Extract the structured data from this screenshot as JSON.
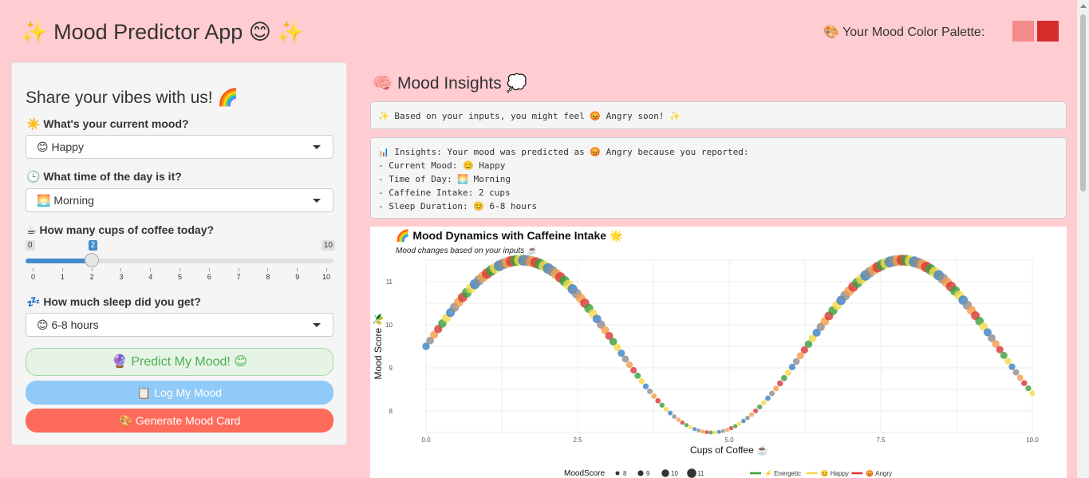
{
  "app": {
    "title": "✨ Mood Predictor App 😊 ✨",
    "palette_label": "🎨 Your Mood Color Palette:",
    "palette_colors": [
      "#f28b8b",
      "#d62c2c"
    ]
  },
  "sidebar": {
    "heading": "Share your vibes with us! 🌈",
    "mood_label": "☀️ What's your current mood?",
    "mood_value": "😊 Happy",
    "time_label": "🕒 What time of the day is it?",
    "time_value": "🌅 Morning",
    "coffee_label": "☕ How many cups of coffee today?",
    "coffee": {
      "min": "0",
      "max": "10",
      "value": "2",
      "value_num": 2,
      "ticks": [
        "0",
        "1",
        "2",
        "3",
        "4",
        "5",
        "6",
        "7",
        "8",
        "9",
        "10"
      ]
    },
    "sleep_label": "💤 How much sleep did you get?",
    "sleep_value": "😊 6-8 hours",
    "predict_button": "🔮 Predict My Mood! 😊",
    "log_button": "📋 Log My Mood",
    "card_button": "🎨 Generate Mood Card"
  },
  "main": {
    "title": "🧠 Mood Insights 💭",
    "prediction_text": "✨ Based on your inputs, you might feel 😡 Angry soon! ✨",
    "insights_text": "📊 Insights: Your mood was predicted as 😡 Angry because you reported:\n- Current Mood: 😊 Happy\n- Time of Day: 🌅 Morning\n- Caffeine Intake: 2 cups\n- Sleep Duration: 😊 6-8 hours"
  },
  "chart_data": {
    "type": "scatter",
    "title": "🌈 Mood Dynamics with Caffeine Intake 🌟",
    "subtitle": "Mood changes based on your inputs ☕",
    "xlabel": "Cups of Coffee ☕",
    "ylabel": "Mood Score 🫒",
    "xlim": [
      0,
      10
    ],
    "ylim": [
      7.5,
      11.5
    ],
    "x_ticks": [
      "0.0",
      "2.5",
      "5.0",
      "7.5",
      "10.0"
    ],
    "y_ticks": [
      "8",
      "9",
      "10",
      "11"
    ],
    "grid": true,
    "curve": "y = 9.5 + 2*sin(x)",
    "n_points": 150,
    "legend": {
      "size_title": "MoodScore",
      "size_values": [
        "8",
        "9",
        "10",
        "11"
      ],
      "color_entries": [
        {
          "label": "⚡ Energetic",
          "color": "#3a9e3a"
        },
        {
          "label": "😊 Happy",
          "color": "#f5d94a"
        },
        {
          "label": "😡 Angry",
          "color": "#d93636"
        }
      ]
    },
    "point_colors": [
      "#d93636",
      "#3a9e3a",
      "#f5d94a",
      "#3b7fc4",
      "#8c8c8c",
      "#f29b4a"
    ]
  }
}
